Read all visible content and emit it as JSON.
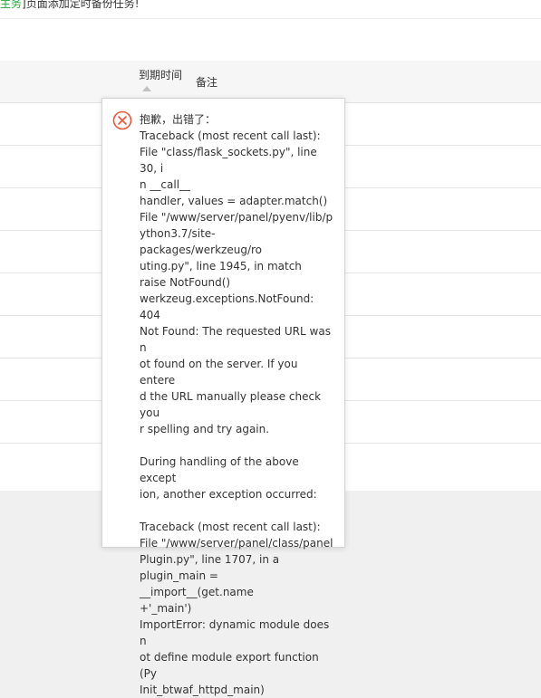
{
  "top_notice": {
    "link_text": "主务",
    "rest_text": "]页面添加定时备份任务!"
  },
  "table": {
    "columns": {
      "due_time": "到期时间",
      "note": "备注"
    }
  },
  "error_dialog": {
    "icon": "error-circle-x-icon",
    "title": "抱歉，出错了：",
    "lines": [
      "Traceback (most recent call last):",
      "File \"class/flask_sockets.py\", line 30, i",
      "n __call__",
      "handler, values = adapter.match()",
      "File \"/www/server/panel/pyenv/lib/p",
      "ython3.7/site-packages/werkzeug/ro",
      "uting.py\", line 1945, in match",
      "raise NotFound()",
      "werkzeug.exceptions.NotFound: 404",
      "Not Found: The requested URL was n",
      "ot found on the server. If you entere",
      "d the URL manually please check you",
      "r spelling and try again.",
      "",
      "During handling of the above except",
      "ion, another exception occurred:",
      "",
      "Traceback (most recent call last):",
      "File \"/www/server/panel/class/panel",
      "Plugin.py\", line 1707, in a",
      "plugin_main = __import__(get.name",
      "+'_main')",
      "ImportError: dynamic module does n",
      "ot define module export function (Py",
      "Init_btwaf_httpd_main)"
    ]
  },
  "colors": {
    "link_green": "#20a53a",
    "error_red": "#e8573e"
  }
}
